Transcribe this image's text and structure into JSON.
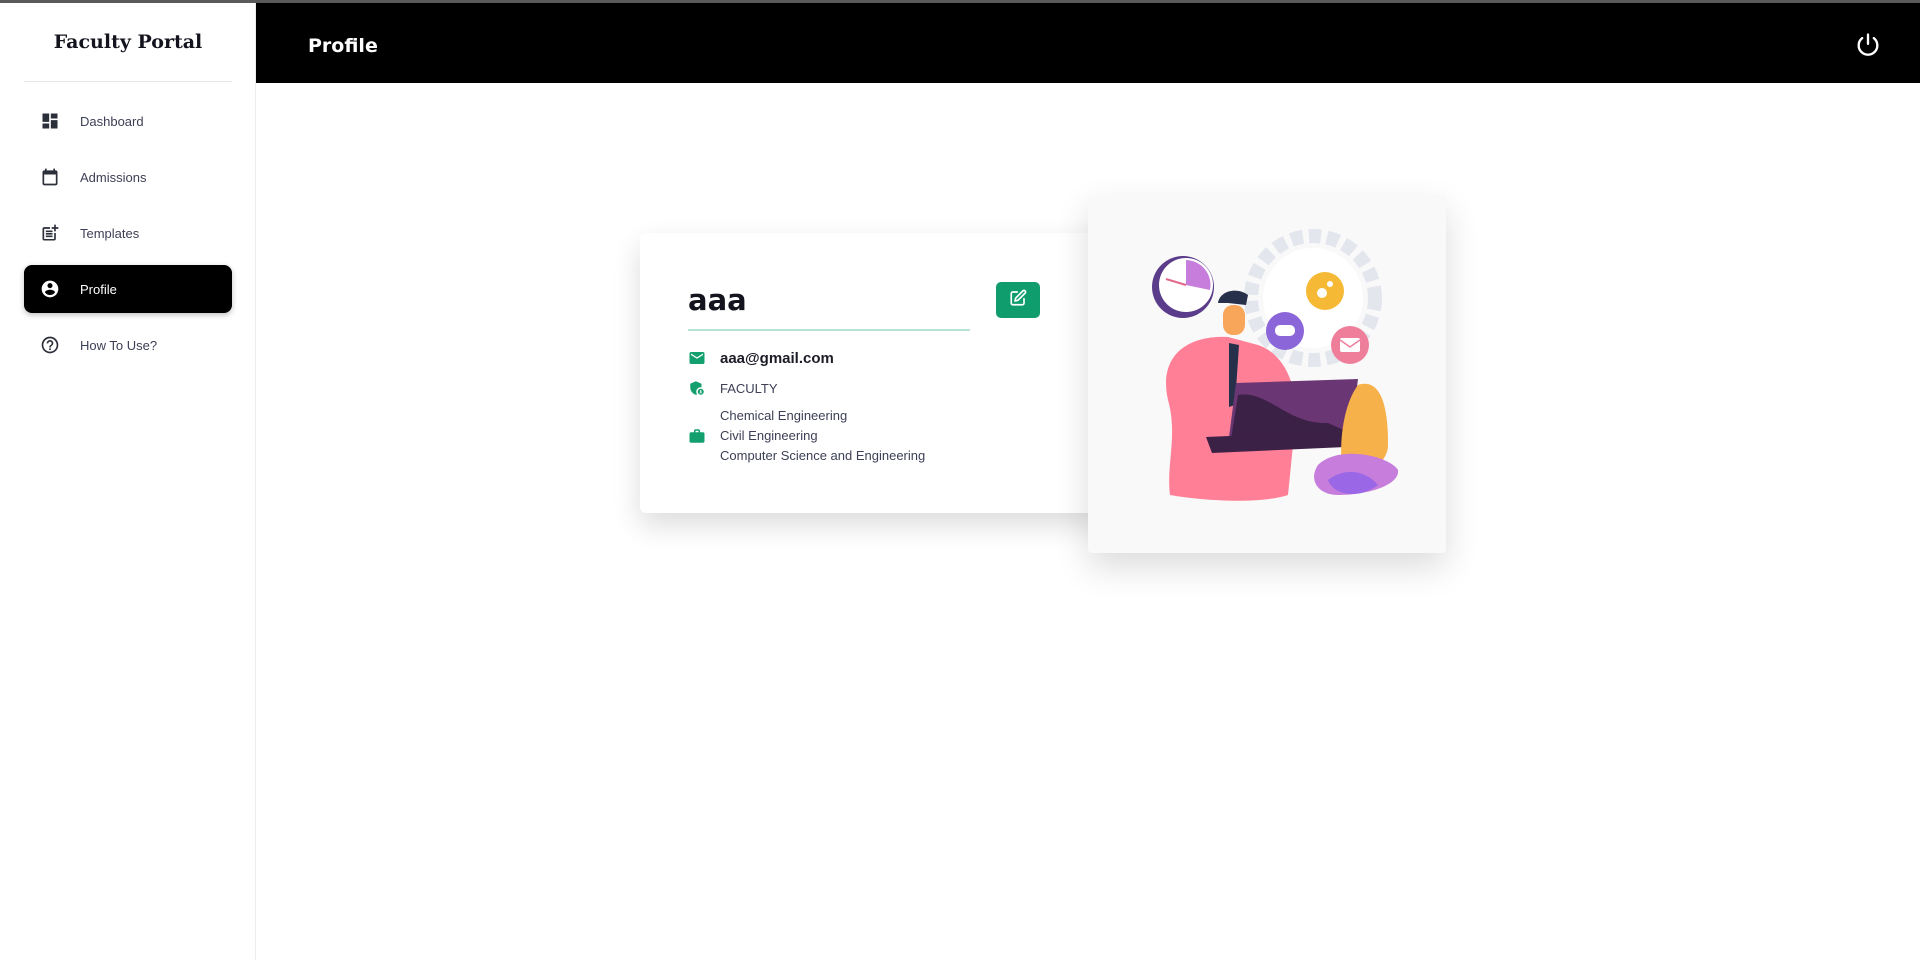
{
  "app": {
    "title": "Faculty Portal"
  },
  "sidebar": {
    "items": [
      {
        "label": "Dashboard",
        "icon": "dashboard-icon",
        "active": false
      },
      {
        "label": "Admissions",
        "icon": "calendar-icon",
        "active": false
      },
      {
        "label": "Templates",
        "icon": "post-add-icon",
        "active": false
      },
      {
        "label": "Profile",
        "icon": "account-circle-icon",
        "active": true
      },
      {
        "label": "How To Use?",
        "icon": "help-icon",
        "active": false
      }
    ]
  },
  "header": {
    "title": "Profile",
    "power_icon": "power-icon"
  },
  "profile": {
    "name": "aaa",
    "email": "aaa@gmail.com",
    "role": "FACULTY",
    "departments": [
      "Chemical Engineering",
      "Civil Engineering",
      "Computer Science and Engineering"
    ],
    "edit_icon": "edit-icon"
  },
  "colors": {
    "accent": "#0f9d6e",
    "active_nav": "#000000",
    "topbar": "#000000"
  }
}
